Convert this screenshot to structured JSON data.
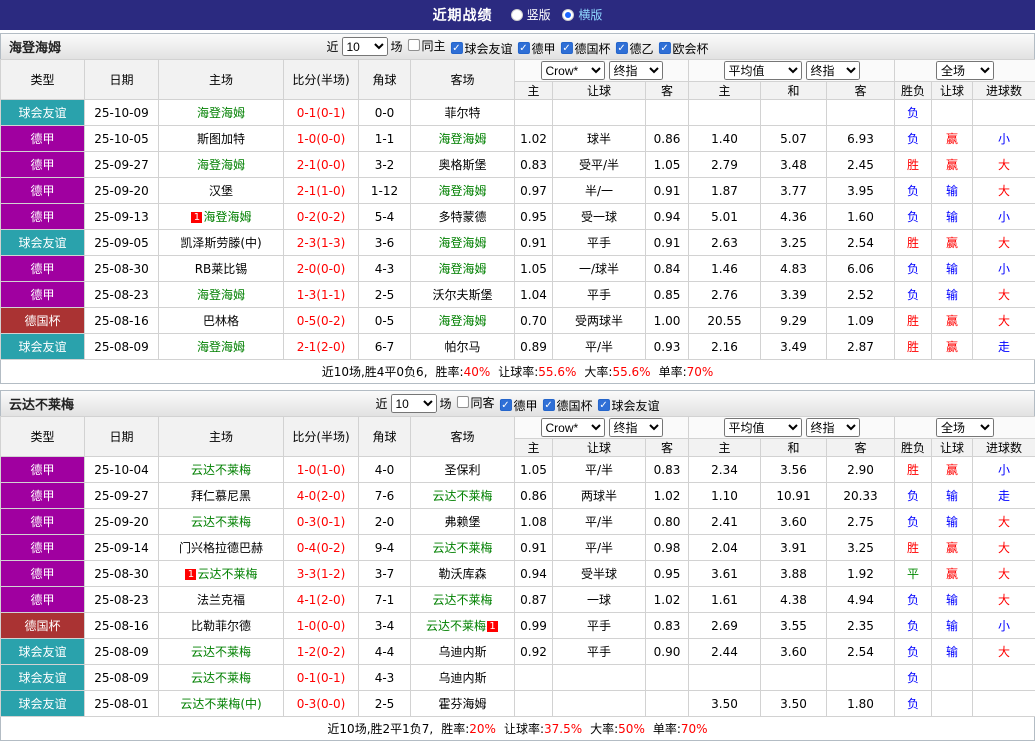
{
  "topbar": {
    "title": "近期战绩",
    "vertical_label": "竖版",
    "horizontal_label": "横版",
    "selected": "横版"
  },
  "table_header": {
    "fixed_columns": [
      "类型",
      "日期",
      "主场",
      "比分(半场)",
      "角球",
      "客场"
    ],
    "asian_selects": [
      "Crow*",
      "终指"
    ],
    "euro_selects": [
      "平均值",
      "终指"
    ],
    "scope_select": "全场",
    "asian_sub": [
      "主",
      "让球",
      "客"
    ],
    "euro_sub": [
      "主",
      "和",
      "客"
    ],
    "result_sub": [
      "胜负",
      "让球",
      "进球数"
    ]
  },
  "colors": {
    "topbar_bg": "#2b2a80",
    "league_types": {
      "friendly": "#2aa2ac",
      "bundesliga": "#a000a0",
      "german_cup": "#aa3333"
    },
    "focus_team": "#008000",
    "score": "#ff0000",
    "results": {
      "red": "#ff0000",
      "blue": "#0000ff",
      "green": "#008800"
    }
  },
  "sections": [
    {
      "team": "海登海姆",
      "filter": {
        "prefix": "近",
        "count": "10",
        "suffix": "场",
        "checkboxes": [
          {
            "label": "同主",
            "checked": false
          },
          {
            "label": "球会友谊",
            "checked": true
          },
          {
            "label": "德甲",
            "checked": true
          },
          {
            "label": "德国杯",
            "checked": true
          },
          {
            "label": "德乙",
            "checked": true
          },
          {
            "label": "欧会杯",
            "checked": true
          }
        ]
      },
      "rows": [
        {
          "lt": "friendly",
          "league": "球会友谊",
          "date": "25-10-09",
          "home": {
            "name": "海登海姆",
            "focus": true
          },
          "score": "0-1(0-1)",
          "corner": "0-0",
          "away": {
            "name": "菲尔特",
            "focus": false
          },
          "odds": [
            "",
            "",
            "",
            "",
            "",
            ""
          ],
          "results": [
            {
              "text": "负",
              "color": "blue"
            },
            {
              "text": "",
              "color": ""
            },
            {
              "text": "",
              "color": ""
            }
          ]
        },
        {
          "lt": "bundesliga",
          "league": "德甲",
          "date": "25-10-05",
          "home": {
            "name": "斯图加特",
            "focus": false
          },
          "score": "1-0(0-0)",
          "corner": "1-1",
          "away": {
            "name": "海登海姆",
            "focus": true
          },
          "odds": [
            "1.02",
            "球半",
            "0.86",
            "1.40",
            "5.07",
            "6.93"
          ],
          "results": [
            {
              "text": "负",
              "color": "blue"
            },
            {
              "text": "赢",
              "color": "red"
            },
            {
              "text": "小",
              "color": "blue"
            }
          ]
        },
        {
          "lt": "bundesliga",
          "league": "德甲",
          "date": "25-09-27",
          "home": {
            "name": "海登海姆",
            "focus": true
          },
          "score": "2-1(0-0)",
          "corner": "3-2",
          "away": {
            "name": "奥格斯堡",
            "focus": false
          },
          "odds": [
            "0.83",
            "受平/半",
            "1.05",
            "2.79",
            "3.48",
            "2.45"
          ],
          "results": [
            {
              "text": "胜",
              "color": "red"
            },
            {
              "text": "赢",
              "color": "red"
            },
            {
              "text": "大",
              "color": "red"
            }
          ]
        },
        {
          "lt": "bundesliga",
          "league": "德甲",
          "date": "25-09-20",
          "home": {
            "name": "汉堡",
            "focus": false
          },
          "score": "2-1(1-0)",
          "corner": "1-12",
          "away": {
            "name": "海登海姆",
            "focus": true
          },
          "odds": [
            "0.97",
            "半/一",
            "0.91",
            "1.87",
            "3.77",
            "3.95"
          ],
          "results": [
            {
              "text": "负",
              "color": "blue"
            },
            {
              "text": "输",
              "color": "blue"
            },
            {
              "text": "大",
              "color": "red"
            }
          ]
        },
        {
          "lt": "bundesliga",
          "league": "德甲",
          "date": "25-09-13",
          "home": {
            "name": "海登海姆",
            "focus": true,
            "mark": "1",
            "mark_pos": "before"
          },
          "score": "0-2(0-2)",
          "corner": "5-4",
          "away": {
            "name": "多特蒙德",
            "focus": false
          },
          "odds": [
            "0.95",
            "受一球",
            "0.94",
            "5.01",
            "4.36",
            "1.60"
          ],
          "results": [
            {
              "text": "负",
              "color": "blue"
            },
            {
              "text": "输",
              "color": "blue"
            },
            {
              "text": "小",
              "color": "blue"
            }
          ]
        },
        {
          "lt": "friendly",
          "league": "球会友谊",
          "date": "25-09-05",
          "home": {
            "name": "凯泽斯劳滕(中)",
            "focus": false
          },
          "score": "2-3(1-3)",
          "corner": "3-6",
          "away": {
            "name": "海登海姆",
            "focus": true
          },
          "odds": [
            "0.91",
            "平手",
            "0.91",
            "2.63",
            "3.25",
            "2.54"
          ],
          "results": [
            {
              "text": "胜",
              "color": "red"
            },
            {
              "text": "赢",
              "color": "red"
            },
            {
              "text": "大",
              "color": "red"
            }
          ]
        },
        {
          "lt": "bundesliga",
          "league": "德甲",
          "date": "25-08-30",
          "home": {
            "name": "RB莱比锡",
            "focus": false
          },
          "score": "2-0(0-0)",
          "corner": "4-3",
          "away": {
            "name": "海登海姆",
            "focus": true
          },
          "odds": [
            "1.05",
            "一/球半",
            "0.84",
            "1.46",
            "4.83",
            "6.06"
          ],
          "results": [
            {
              "text": "负",
              "color": "blue"
            },
            {
              "text": "输",
              "color": "blue"
            },
            {
              "text": "小",
              "color": "blue"
            }
          ]
        },
        {
          "lt": "bundesliga",
          "league": "德甲",
          "date": "25-08-23",
          "home": {
            "name": "海登海姆",
            "focus": true
          },
          "score": "1-3(1-1)",
          "corner": "2-5",
          "away": {
            "name": "沃尔夫斯堡",
            "focus": false
          },
          "odds": [
            "1.04",
            "平手",
            "0.85",
            "2.76",
            "3.39",
            "2.52"
          ],
          "results": [
            {
              "text": "负",
              "color": "blue"
            },
            {
              "text": "输",
              "color": "blue"
            },
            {
              "text": "大",
              "color": "red"
            }
          ]
        },
        {
          "lt": "german_cup",
          "league": "德国杯",
          "date": "25-08-16",
          "home": {
            "name": "巴林格",
            "focus": false
          },
          "score": "0-5(0-2)",
          "corner": "0-5",
          "away": {
            "name": "海登海姆",
            "focus": true
          },
          "odds": [
            "0.70",
            "受两球半",
            "1.00",
            "20.55",
            "9.29",
            "1.09"
          ],
          "results": [
            {
              "text": "胜",
              "color": "red"
            },
            {
              "text": "赢",
              "color": "red"
            },
            {
              "text": "大",
              "color": "red"
            }
          ]
        },
        {
          "lt": "friendly",
          "league": "球会友谊",
          "date": "25-08-09",
          "home": {
            "name": "海登海姆",
            "focus": true
          },
          "score": "2-1(2-0)",
          "corner": "6-7",
          "away": {
            "name": "帕尔马",
            "focus": false
          },
          "odds": [
            "0.89",
            "平/半",
            "0.93",
            "2.16",
            "3.49",
            "2.87"
          ],
          "results": [
            {
              "text": "胜",
              "color": "red"
            },
            {
              "text": "赢",
              "color": "red"
            },
            {
              "text": "走",
              "color": "blue"
            }
          ]
        }
      ],
      "summary": {
        "prefix": "近10场,胜4平0负6,",
        "stats": [
          {
            "label": "胜率:",
            "value": "40%"
          },
          {
            "label": "让球率:",
            "value": "55.6%"
          },
          {
            "label": "大率:",
            "value": "55.6%"
          },
          {
            "label": "单率:",
            "value": "70%"
          }
        ]
      }
    },
    {
      "team": "云达不莱梅",
      "filter": {
        "prefix": "近",
        "count": "10",
        "suffix": "场",
        "checkboxes": [
          {
            "label": "同客",
            "checked": false
          },
          {
            "label": "德甲",
            "checked": true
          },
          {
            "label": "德国杯",
            "checked": true
          },
          {
            "label": "球会友谊",
            "checked": true
          }
        ]
      },
      "rows": [
        {
          "lt": "bundesliga",
          "league": "德甲",
          "date": "25-10-04",
          "home": {
            "name": "云达不莱梅",
            "focus": true
          },
          "score": "1-0(1-0)",
          "corner": "4-0",
          "away": {
            "name": "圣保利",
            "focus": false
          },
          "odds": [
            "1.05",
            "平/半",
            "0.83",
            "2.34",
            "3.56",
            "2.90"
          ],
          "results": [
            {
              "text": "胜",
              "color": "red"
            },
            {
              "text": "赢",
              "color": "red"
            },
            {
              "text": "小",
              "color": "blue"
            }
          ]
        },
        {
          "lt": "bundesliga",
          "league": "德甲",
          "date": "25-09-27",
          "home": {
            "name": "拜仁慕尼黑",
            "focus": false
          },
          "score": "4-0(2-0)",
          "corner": "7-6",
          "away": {
            "name": "云达不莱梅",
            "focus": true
          },
          "odds": [
            "0.86",
            "两球半",
            "1.02",
            "1.10",
            "10.91",
            "20.33"
          ],
          "results": [
            {
              "text": "负",
              "color": "blue"
            },
            {
              "text": "输",
              "color": "blue"
            },
            {
              "text": "走",
              "color": "blue"
            }
          ]
        },
        {
          "lt": "bundesliga",
          "league": "德甲",
          "date": "25-09-20",
          "home": {
            "name": "云达不莱梅",
            "focus": true
          },
          "score": "0-3(0-1)",
          "corner": "2-0",
          "away": {
            "name": "弗赖堡",
            "focus": false
          },
          "odds": [
            "1.08",
            "平/半",
            "0.80",
            "2.41",
            "3.60",
            "2.75"
          ],
          "results": [
            {
              "text": "负",
              "color": "blue"
            },
            {
              "text": "输",
              "color": "blue"
            },
            {
              "text": "大",
              "color": "red"
            }
          ]
        },
        {
          "lt": "bundesliga",
          "league": "德甲",
          "date": "25-09-14",
          "home": {
            "name": "门兴格拉德巴赫",
            "focus": false
          },
          "score": "0-4(0-2)",
          "corner": "9-4",
          "away": {
            "name": "云达不莱梅",
            "focus": true
          },
          "odds": [
            "0.91",
            "平/半",
            "0.98",
            "2.04",
            "3.91",
            "3.25"
          ],
          "results": [
            {
              "text": "胜",
              "color": "red"
            },
            {
              "text": "赢",
              "color": "red"
            },
            {
              "text": "大",
              "color": "red"
            }
          ]
        },
        {
          "lt": "bundesliga",
          "league": "德甲",
          "date": "25-08-30",
          "home": {
            "name": "云达不莱梅",
            "focus": true,
            "mark": "1",
            "mark_pos": "before"
          },
          "score": "3-3(1-2)",
          "corner": "3-7",
          "away": {
            "name": "勒沃库森",
            "focus": false
          },
          "odds": [
            "0.94",
            "受半球",
            "0.95",
            "3.61",
            "3.88",
            "1.92"
          ],
          "results": [
            {
              "text": "平",
              "color": "green"
            },
            {
              "text": "赢",
              "color": "red"
            },
            {
              "text": "大",
              "color": "red"
            }
          ]
        },
        {
          "lt": "bundesliga",
          "league": "德甲",
          "date": "25-08-23",
          "home": {
            "name": "法兰克福",
            "focus": false
          },
          "score": "4-1(2-0)",
          "corner": "7-1",
          "away": {
            "name": "云达不莱梅",
            "focus": true
          },
          "odds": [
            "0.87",
            "一球",
            "1.02",
            "1.61",
            "4.38",
            "4.94"
          ],
          "results": [
            {
              "text": "负",
              "color": "blue"
            },
            {
              "text": "输",
              "color": "blue"
            },
            {
              "text": "大",
              "color": "red"
            }
          ]
        },
        {
          "lt": "german_cup",
          "league": "德国杯",
          "date": "25-08-16",
          "home": {
            "name": "比勒菲尔德",
            "focus": false
          },
          "score": "1-0(0-0)",
          "corner": "3-4",
          "away": {
            "name": "云达不莱梅",
            "focus": true,
            "mark": "1",
            "mark_pos": "after"
          },
          "odds": [
            "0.99",
            "平手",
            "0.83",
            "2.69",
            "3.55",
            "2.35"
          ],
          "results": [
            {
              "text": "负",
              "color": "blue"
            },
            {
              "text": "输",
              "color": "blue"
            },
            {
              "text": "小",
              "color": "blue"
            }
          ]
        },
        {
          "lt": "friendly",
          "league": "球会友谊",
          "date": "25-08-09",
          "home": {
            "name": "云达不莱梅",
            "focus": true
          },
          "score": "1-2(0-2)",
          "corner": "4-4",
          "away": {
            "name": "乌迪内斯",
            "focus": false
          },
          "odds": [
            "0.92",
            "平手",
            "0.90",
            "2.44",
            "3.60",
            "2.54"
          ],
          "results": [
            {
              "text": "负",
              "color": "blue"
            },
            {
              "text": "输",
              "color": "blue"
            },
            {
              "text": "大",
              "color": "red"
            }
          ]
        },
        {
          "lt": "friendly",
          "league": "球会友谊",
          "date": "25-08-09",
          "home": {
            "name": "云达不莱梅",
            "focus": true
          },
          "score": "0-1(0-1)",
          "corner": "4-3",
          "away": {
            "name": "乌迪内斯",
            "focus": false
          },
          "odds": [
            "",
            "",
            "",
            "",
            "",
            ""
          ],
          "results": [
            {
              "text": "负",
              "color": "blue"
            },
            {
              "text": "",
              "color": ""
            },
            {
              "text": "",
              "color": ""
            }
          ]
        },
        {
          "lt": "friendly",
          "league": "球会友谊",
          "date": "25-08-01",
          "home": {
            "name": "云达不莱梅(中)",
            "focus": true
          },
          "score": "0-3(0-0)",
          "corner": "2-5",
          "away": {
            "name": "霍芬海姆",
            "focus": false
          },
          "odds": [
            "",
            "",
            "",
            "3.50",
            "3.50",
            "1.80"
          ],
          "results": [
            {
              "text": "负",
              "color": "blue"
            },
            {
              "text": "",
              "color": ""
            },
            {
              "text": "",
              "color": ""
            }
          ]
        }
      ],
      "summary": {
        "prefix": "近10场,胜2平1负7,",
        "stats": [
          {
            "label": "胜率:",
            "value": "20%"
          },
          {
            "label": "让球率:",
            "value": "37.5%"
          },
          {
            "label": "大率:",
            "value": "50%"
          },
          {
            "label": "单率:",
            "value": "70%"
          }
        ]
      }
    }
  ]
}
